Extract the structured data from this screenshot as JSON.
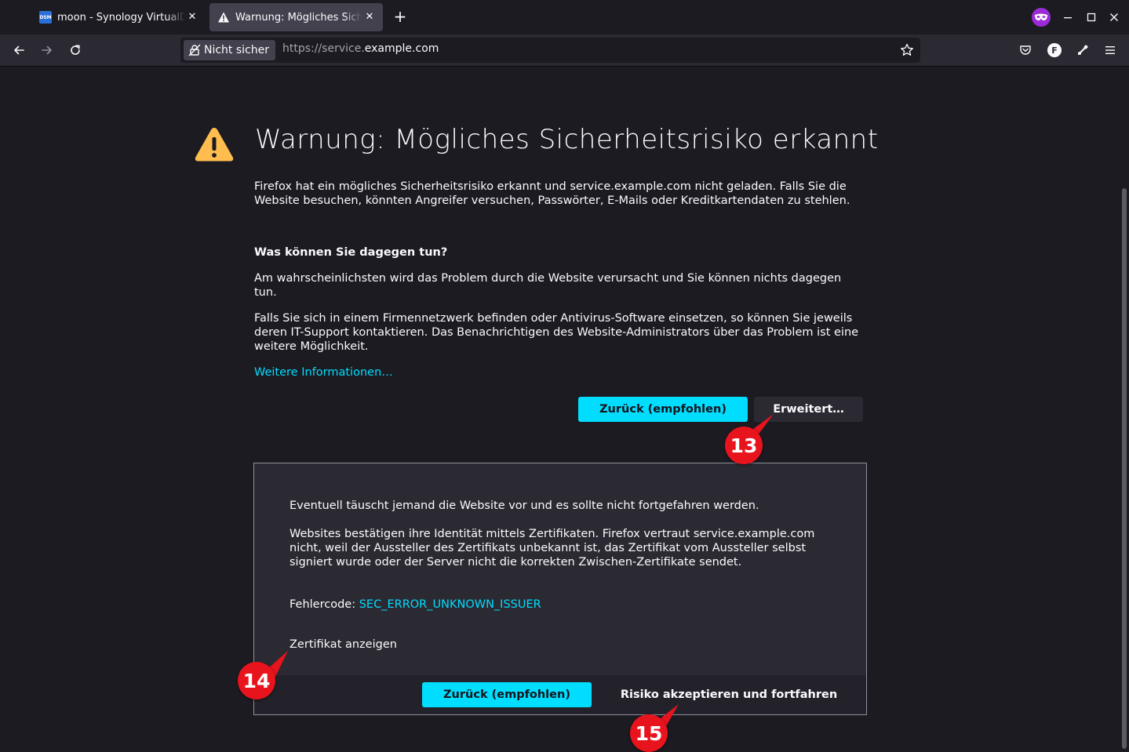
{
  "browser": {
    "tabs": [
      {
        "title": "moon - Synology VirtualDSM",
        "favicon_text": "DSM",
        "active": false
      },
      {
        "title": "Warnung: Mögliches Sicherheitsrisiko",
        "active": true
      }
    ],
    "new_tab_label": "+",
    "nav": {
      "identity_label": "Nicht sicher",
      "url_prefix": "https://service.",
      "url_domain": "example.com",
      "account_letter": "F"
    }
  },
  "page": {
    "title": "Warnung: Mögliches Sicherheitsrisiko erkannt",
    "intro": "Firefox hat ein mögliches Sicherheitsrisiko erkannt und service.example.com nicht geladen. Falls Sie die Website besuchen, könnten Angreifer versuchen, Passwörter, E-Mails oder Kreditkartendaten zu stehlen.",
    "what_heading": "Was können Sie dagegen tun?",
    "para1": "Am wahrscheinlichsten wird das Problem durch die Website verursacht und Sie können nichts dagegen tun.",
    "para2": "Falls Sie sich in einem Firmennetzwerk befinden oder Antivirus-Software einsetzen, so können Sie jeweils deren IT-Support kontaktieren. Das Benachrichtigen des Website-Administrators über das Problem ist eine weitere Möglichkeit.",
    "more_info_link": "Weitere Informationen…",
    "back_button": "Zurück (empfohlen)",
    "advanced_button": "Erweitert…"
  },
  "advanced": {
    "text1": "Eventuell täuscht jemand die Website vor und es sollte nicht fortgefahren werden.",
    "text2": "Websites bestätigen ihre Identität mittels Zertifikaten. Firefox vertraut service.example.com nicht, weil der Aussteller des Zertifikats unbekannt ist, das Zertifikat vom Aussteller selbst signiert wurde oder der Server nicht die korrekten Zwischen-Zertifikate sendet.",
    "error_code_label": "Fehlercode: ",
    "error_code": "SEC_ERROR_UNKNOWN_ISSUER",
    "view_cert_link": "Zertifikat anzeigen",
    "back_button": "Zurück (empfohlen)",
    "accept_button": "Risiko akzeptieren und fortfahren"
  },
  "annotations": [
    "13",
    "14",
    "15"
  ],
  "colors": {
    "accent": "#00ddff",
    "background": "#1c1b22",
    "warning": "#ffbd4f",
    "badge": "#e8141d"
  }
}
